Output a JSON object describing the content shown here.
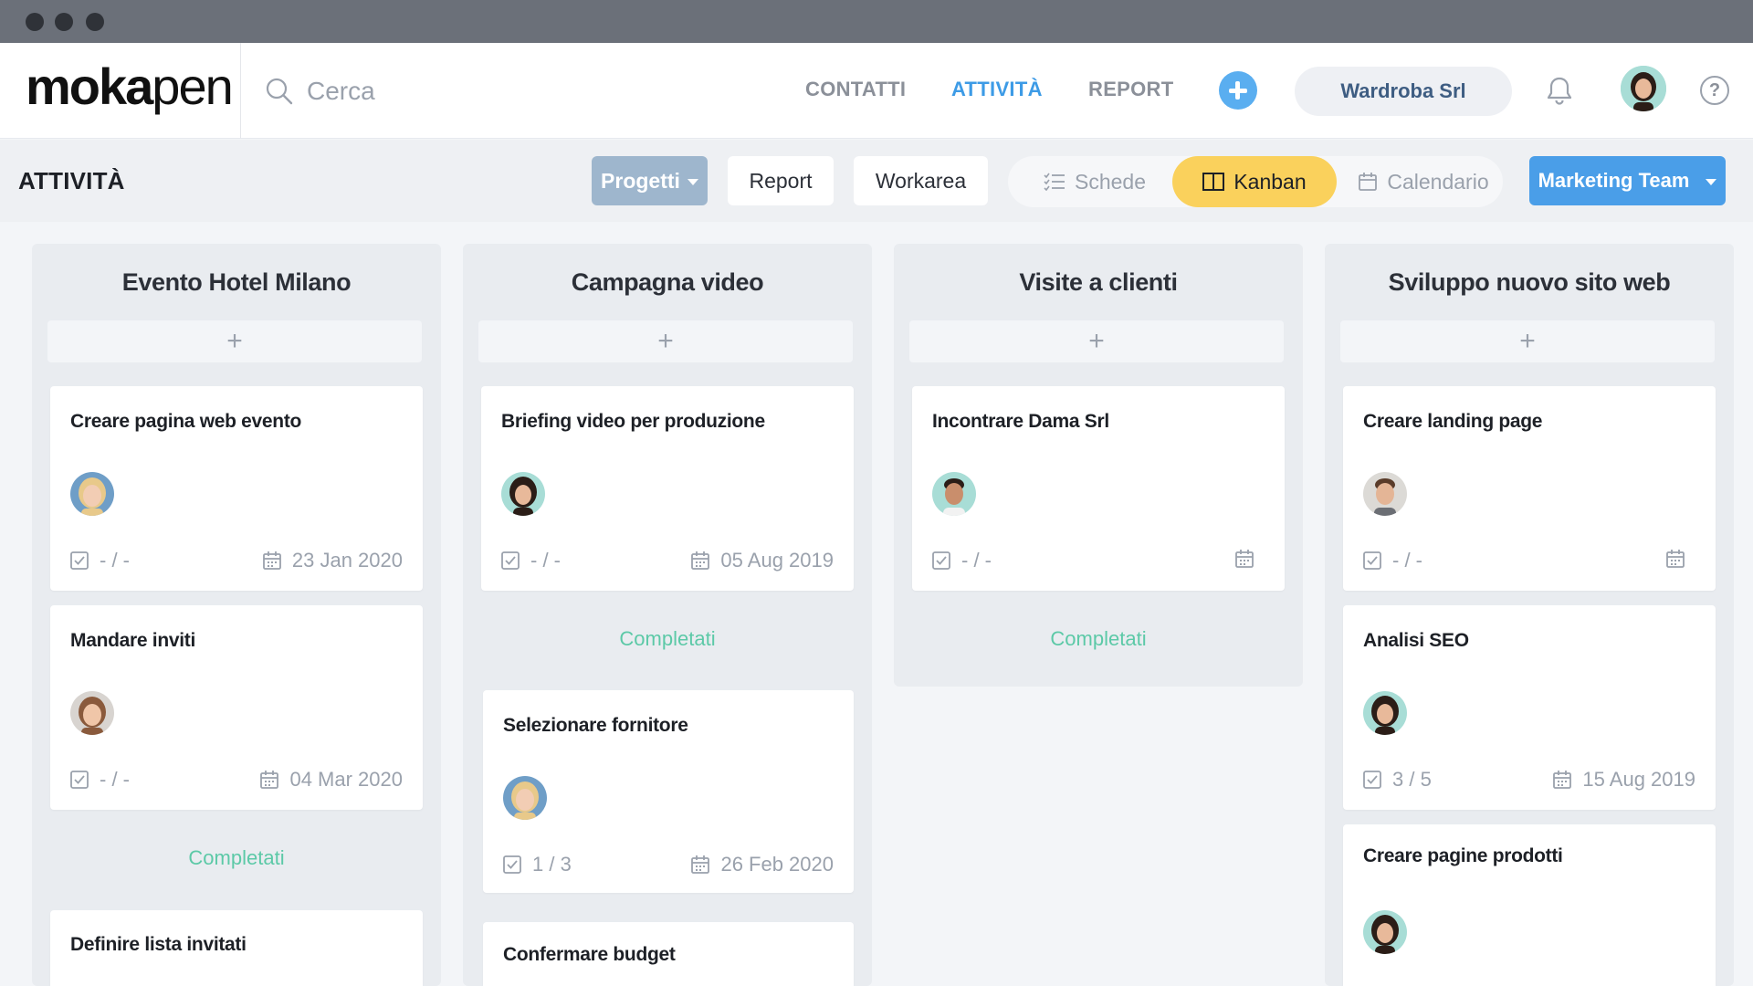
{
  "app": {
    "logo_bold": "moka",
    "logo_light": "pen"
  },
  "search": {
    "placeholder": "Cerca"
  },
  "nav": {
    "contacts": "CONTATTI",
    "activities": "ATTIVITÀ",
    "reports": "REPORT"
  },
  "company": "Wardroba Srl",
  "subbar": {
    "title": "ATTIVITÀ",
    "projects": "Progetti",
    "report": "Report",
    "workarea": "Workarea",
    "view_cards": "Schede",
    "view_kanban": "Kanban",
    "view_calendar": "Calendario",
    "team": "Marketing Team"
  },
  "colors": {
    "accent": "#4a9ee8",
    "kanban_active": "#fad15c",
    "completed": "#5cc9a7"
  },
  "columns": [
    {
      "title": "Evento Hotel Milano",
      "add": "+",
      "cards": [
        {
          "title": "Creare pagina web evento",
          "checklist": "- / -",
          "date": "23 Jan 2020",
          "avatar": "woman-blonde"
        },
        {
          "title": "Mandare inviti",
          "checklist": "- / -",
          "date": "04 Mar 2020",
          "avatar": "woman-brown"
        },
        {
          "title": "Definire lista invitati"
        }
      ],
      "completed": "Completati"
    },
    {
      "title": "Campagna video",
      "add": "+",
      "cards": [
        {
          "title": "Briefing video per produzione",
          "checklist": "- / -",
          "date": "05 Aug 2019",
          "avatar": "woman-dark"
        },
        {
          "title": "Selezionare fornitore",
          "checklist": "1 / 3",
          "date": "26 Feb 2020",
          "avatar": "woman-blonde"
        },
        {
          "title": "Confermare budget"
        }
      ],
      "completed": "Completati"
    },
    {
      "title": "Visite a clienti",
      "add": "+",
      "cards": [
        {
          "title": "Incontrare Dama Srl",
          "checklist": "- / -",
          "date": "",
          "avatar": "man-dark"
        }
      ],
      "completed": "Completati"
    },
    {
      "title": "Sviluppo nuovo sito web",
      "add": "+",
      "cards": [
        {
          "title": "Creare landing page",
          "checklist": "- / -",
          "date": "",
          "avatar": "man-light"
        },
        {
          "title": "Analisi SEO",
          "checklist": "3 / 5",
          "date": "15 Aug 2019",
          "avatar": "woman-dark"
        },
        {
          "title": "Creare pagine prodotti",
          "avatar": "woman-dark"
        }
      ]
    }
  ]
}
